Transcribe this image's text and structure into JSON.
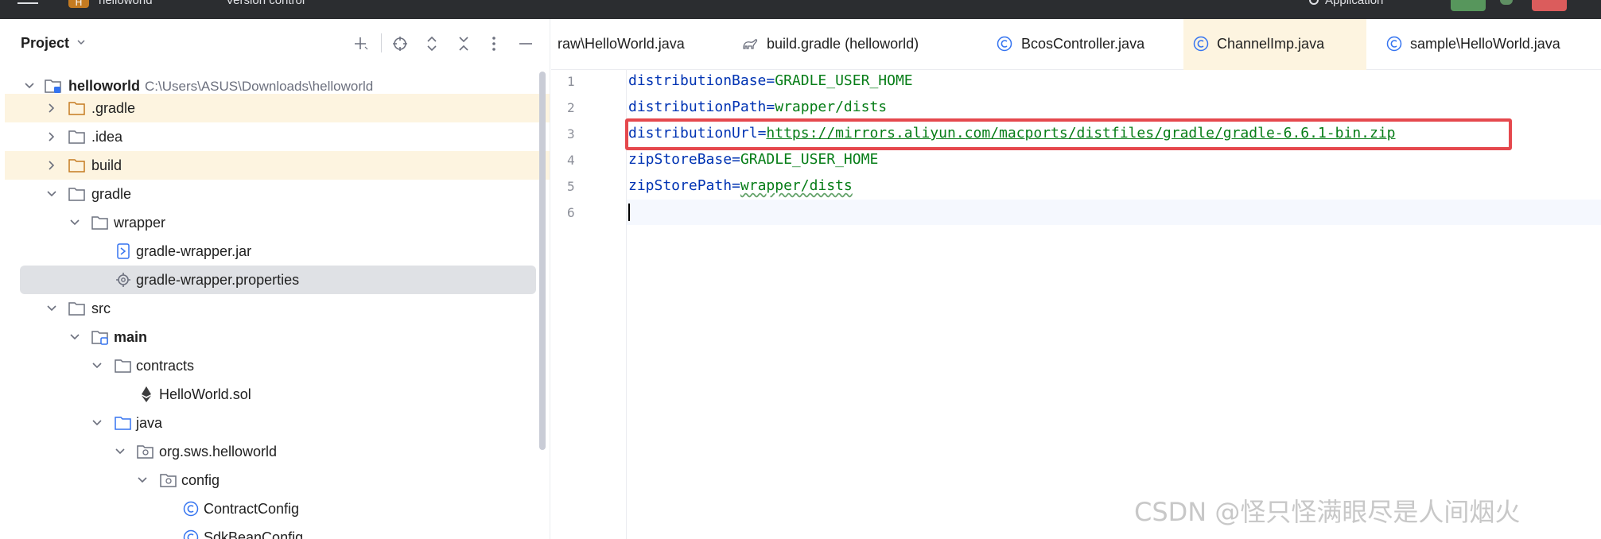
{
  "topbar": {
    "project_badge": "H",
    "project_name": "helloworld",
    "vcs_label": "Version control",
    "run_config": "Application"
  },
  "project_panel": {
    "title": "Project",
    "tree": [
      {
        "label": "helloworld",
        "path": "C:\\Users\\ASUS\\Downloads\\helloworld",
        "bold": true,
        "expanded": true,
        "icon": "module-folder-icon"
      },
      {
        "label": ".gradle",
        "expanded": false,
        "icon": "folder-orange-icon",
        "highlight": true
      },
      {
        "label": ".idea",
        "expanded": false,
        "icon": "folder-icon"
      },
      {
        "label": "build",
        "expanded": false,
        "icon": "folder-orange-icon",
        "highlight": true
      },
      {
        "label": "gradle",
        "expanded": true,
        "icon": "folder-icon"
      },
      {
        "label": "wrapper",
        "expanded": true,
        "icon": "folder-icon"
      },
      {
        "label": "gradle-wrapper.jar",
        "icon": "jar-icon"
      },
      {
        "label": "gradle-wrapper.properties",
        "icon": "properties-gear-icon",
        "selected": true
      },
      {
        "label": "src",
        "expanded": true,
        "icon": "folder-icon"
      },
      {
        "label": "main",
        "bold": true,
        "expanded": true,
        "icon": "source-root-folder-icon"
      },
      {
        "label": "contracts",
        "expanded": true,
        "icon": "folder-icon"
      },
      {
        "label": "HelloWorld.sol",
        "icon": "ethereum-icon"
      },
      {
        "label": "java",
        "expanded": true,
        "icon": "folder-blue-icon"
      },
      {
        "label": "org.sws.helloworld",
        "expanded": true,
        "icon": "package-icon"
      },
      {
        "label": "config",
        "expanded": true,
        "icon": "package-icon"
      },
      {
        "label": "ContractConfig",
        "icon": "class-icon"
      },
      {
        "label": "SdkBeanConfig",
        "icon": "class-icon"
      }
    ]
  },
  "editor_tabs": [
    {
      "label": "raw\\HelloWorld.java",
      "icon": ""
    },
    {
      "label": "build.gradle (helloworld)",
      "icon": "gradle-icon"
    },
    {
      "label": "BcosController.java",
      "icon": "class-icon"
    },
    {
      "label": "ChannelImp.java",
      "icon": "class-icon",
      "active": true
    },
    {
      "label": "sample\\HelloWorld.java",
      "icon": "class-icon"
    }
  ],
  "editor": {
    "line_numbers": [
      "1",
      "2",
      "3",
      "4",
      "5",
      "6"
    ],
    "lines": [
      {
        "key": "distributionBase",
        "value": "GRADLE_USER_HOME"
      },
      {
        "key": "distributionPath",
        "value": "wrapper/dists"
      },
      {
        "key": "distributionUrl",
        "value": "https://mirrors.aliyun.com/macports/distfiles/gradle/gradle-6.6.1-bin.zip"
      },
      {
        "key": "zipStoreBase",
        "value": "GRADLE_USER_HOME"
      },
      {
        "key": "zipStorePath",
        "value": "wrapper/dists"
      },
      {
        "key": "",
        "value": ""
      }
    ],
    "eq": "="
  },
  "watermark": "CSDN @怪只怪满眼尽是人间烟火",
  "colors": {
    "highlight_row": "#fdf4e0",
    "selected_row": "#dfe1e5",
    "key": "#0033b3",
    "value": "#067d17",
    "annotation_box": "#e5484d"
  }
}
